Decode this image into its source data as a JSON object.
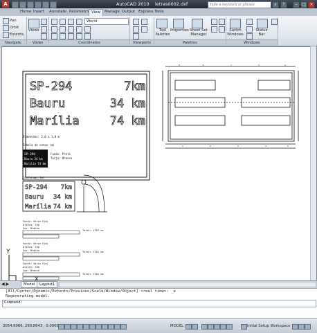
{
  "window": {
    "app_name": "AutoCAD 2010",
    "file_name": "letras0002.dxf",
    "search_placeholder": "Type a keyword or phrase"
  },
  "menu_tabs": [
    "Home",
    "Insert",
    "Annotate",
    "Parametric",
    "View",
    "Manage",
    "Output",
    "Express Tools"
  ],
  "active_tab": "View",
  "ribbon": {
    "navigate": {
      "title": "Navigate",
      "items": [
        "Pan",
        "Orbit",
        "Extents"
      ]
    },
    "views": {
      "title": "Views",
      "button": "Views"
    },
    "coordinates": {
      "title": "Coordinates",
      "ucs_value": "World"
    },
    "viewports": {
      "title": "Viewports"
    },
    "palettes": {
      "title": "Palettes",
      "buttons": [
        "Tool Palettes",
        "Properties",
        "Sheet Set Manager"
      ]
    },
    "windows": {
      "title": "Windows",
      "buttons": [
        "Switch Windows",
        "Status Bar"
      ]
    }
  },
  "drawing": {
    "sign_lines": [
      {
        "place": "SP-294",
        "dist": "7km"
      },
      {
        "place": "Bauru",
        "dist": "34 km"
      },
      {
        "place": "Marília",
        "dist": "74 km"
      }
    ],
    "dimension_note": "Dimensões: 2,0 x 1,0 m",
    "table_label": "Tabela de cotas (m)",
    "small_sign": {
      "title": "SP-294",
      "lines": [
        "Bauru 34 km",
        "Marília 74 km"
      ],
      "notes": [
        "Fundo: Preto",
        "Tarja: Branco"
      ]
    },
    "scaled_label": "Conformar (m)",
    "font_blocks": [
      {
        "lines": [
          "Fonte: Serie E(m)",
          "Altura: 150",
          "Cor: Branco"
        ],
        "total": "Total= 1742 cm"
      },
      {
        "lines": [
          "Fonte: Serie E(m)",
          "Altura: 150",
          "Cor: Branco"
        ],
        "total": "Total= 1742 cm"
      },
      {
        "lines": [
          "Fonte: Serie E(m)",
          "Altura: 150",
          "Cor: Branco"
        ],
        "total": "Total= 1742 cm"
      }
    ],
    "ucs_x": "X",
    "ucs_y": "Y"
  },
  "layout_tabs": [
    "Model",
    "Layout1"
  ],
  "command": {
    "history": [
      "[All/Center/Dynamic/Extents/Previous/Scale/Window/Object] <real time>: _e",
      "Regenerating model."
    ],
    "prompt": "Command:"
  },
  "status": {
    "coords": "3054.6066, 290.8643 , 0.0000",
    "model_label": "MODEL",
    "workspace": "Initial Setup Workspace"
  }
}
